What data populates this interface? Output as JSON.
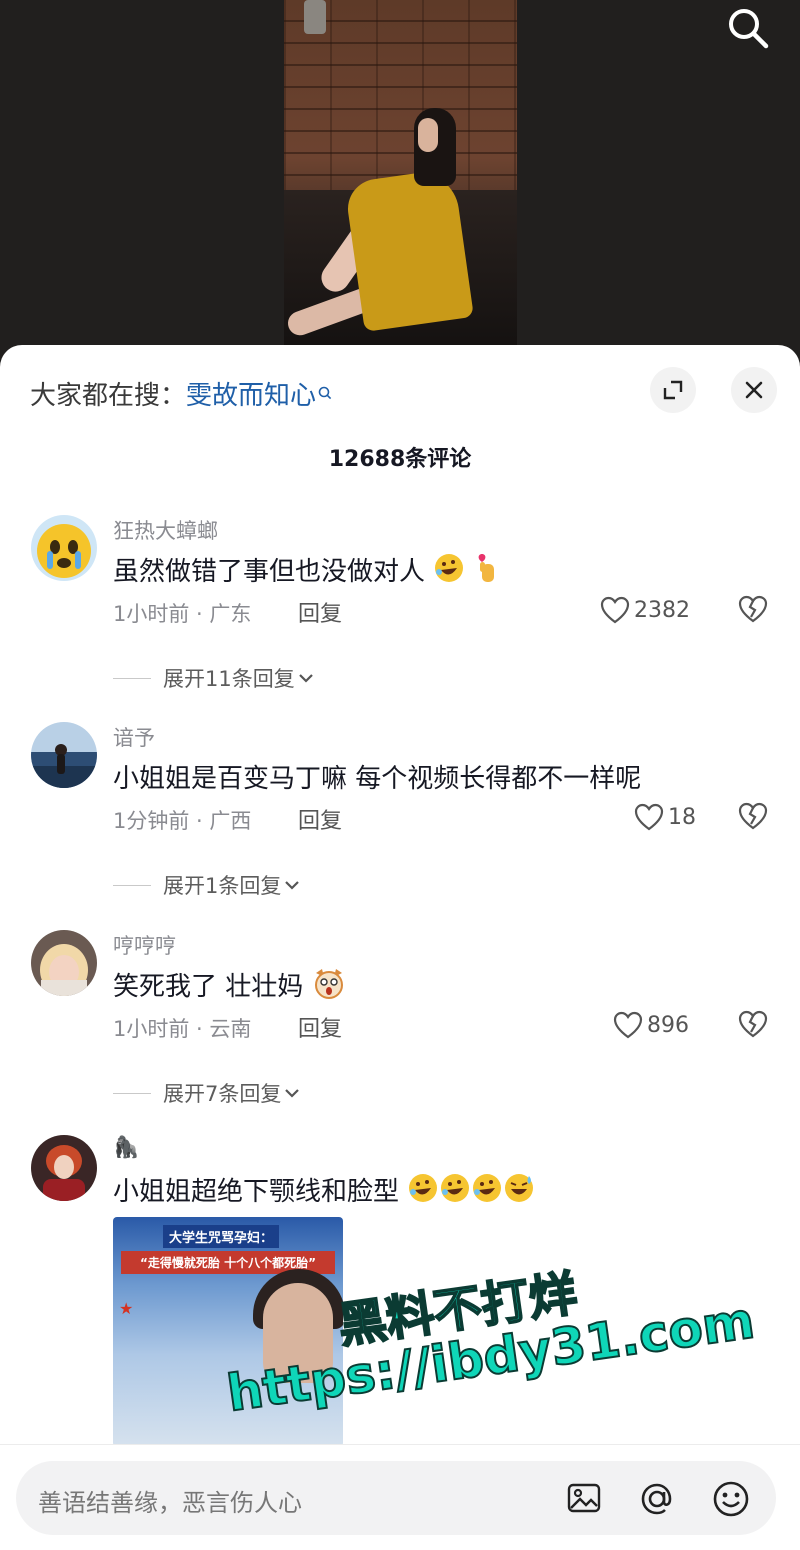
{
  "video": {
    "search_icon": "search-icon"
  },
  "search_hint": {
    "prefix": "大家都在搜：",
    "keyword": "雯故而知心"
  },
  "comments_header": {
    "count_label": "12688条评论"
  },
  "comments": [
    {
      "user": "狂热大蟑螂",
      "text": "虽然做错了事但也没做对人",
      "emojis": [
        "rofl-emoji",
        "finger-heart-emoji"
      ],
      "time": "1小时前",
      "location": "广东",
      "reply_label": "回复",
      "likes": "2382",
      "expand_label": "展开11条回复"
    },
    {
      "user": "谙予",
      "text": "小姐姐是百变马丁嘛 每个视频长得都不一样呢",
      "time": "1分钟前",
      "location": "广西",
      "reply_label": "回复",
      "likes": "18",
      "expand_label": "展开1条回复"
    },
    {
      "user": "哼哼哼",
      "text": "笑死我了 壮壮妈",
      "emojis": [
        "shocked-dog-emoji"
      ],
      "time": "1小时前",
      "location": "云南",
      "reply_label": "回复",
      "likes": "896",
      "expand_label": "展开7条回复"
    },
    {
      "user": "🦍",
      "text": "小姐姐超绝下颚线和脸型",
      "emojis": [
        "rofl-emoji",
        "rofl-emoji",
        "rofl-emoji",
        "sweat-laugh-emoji"
      ],
      "image": {
        "banner": "大学生咒骂孕妇：",
        "quote": "“走得慢就死胎 十个八个都死胎”"
      }
    }
  ],
  "watermark": {
    "line1": "黑料不打烊",
    "line2": "https://ibdy31.com"
  },
  "input": {
    "placeholder": "善语结善缘，恶言伤人心"
  },
  "colors": {
    "keyword": "#1f5fa8",
    "sheet": "#ffffff",
    "video_bg": "#211f1e",
    "watermark": "#0fd6b8"
  }
}
